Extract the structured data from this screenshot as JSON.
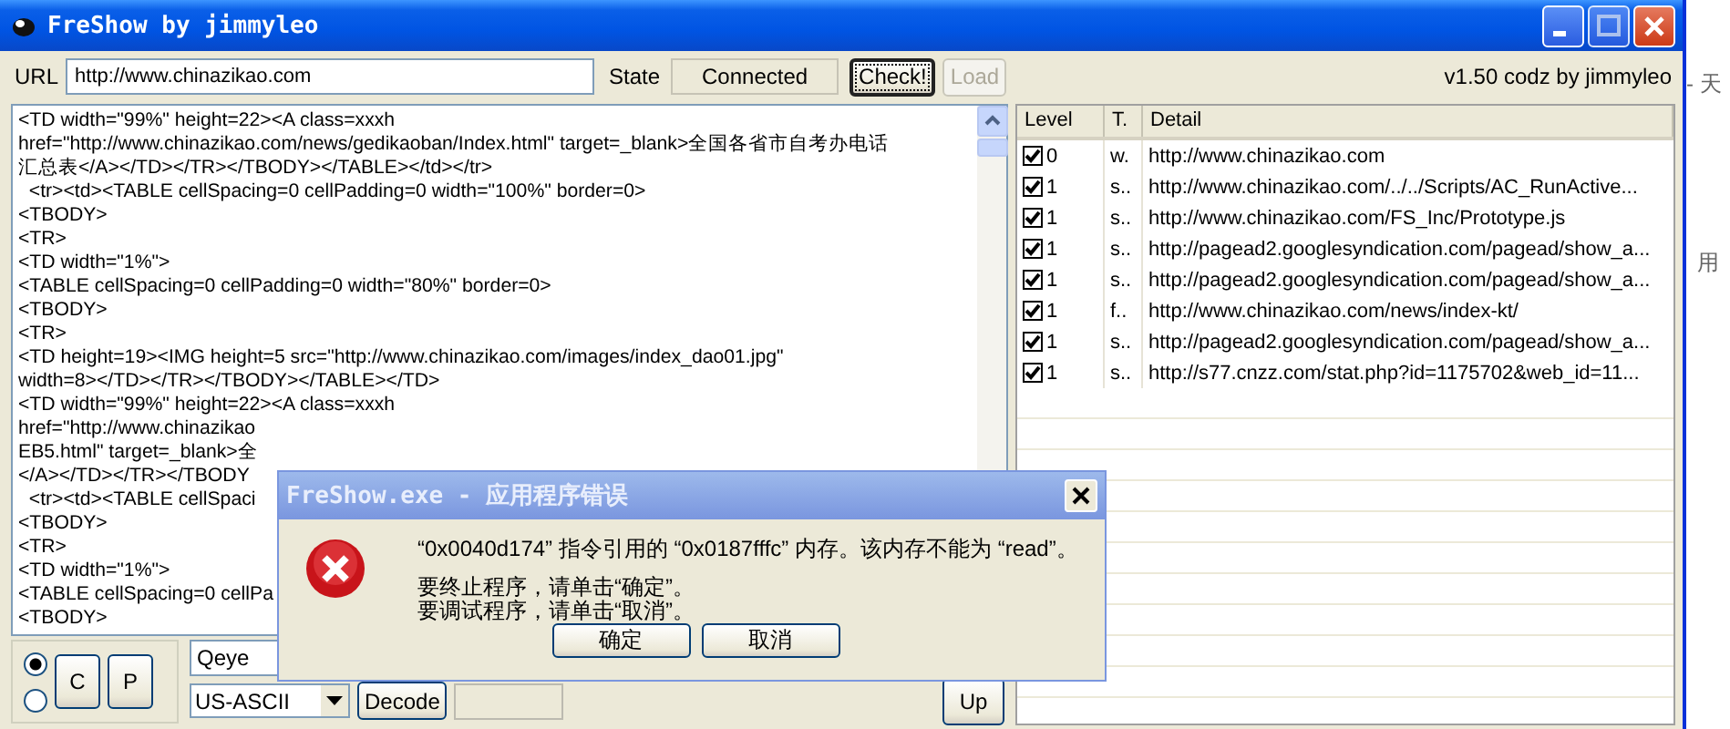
{
  "window": {
    "title": "FreShow by jimmyleo"
  },
  "toolbar": {
    "url_label": "URL",
    "url": "http://www.chinazikao.com",
    "state_label": "State",
    "state": "Connected",
    "buttons": [
      {
        "label": "Check!",
        "disabled": false,
        "focused": true
      },
      {
        "label": "Load",
        "disabled": true,
        "focused": false
      }
    ],
    "version": "v1.50 codz by jimmyleo"
  },
  "source_lines": [
    "<TD width=\"99%\" height=22><A class=xxxh",
    "href=\"http://www.chinazikao.com/news/gedikaoban/Index.html\" target=_blank>全国各省市自考办电话",
    "汇总表</A></TD></TR></TBODY></TABLE></td></tr>",
    "  <tr><td><TABLE cellSpacing=0 cellPadding=0 width=\"100%\" border=0>",
    "<TBODY>",
    "<TR>",
    "<TD width=\"1%\">",
    "<TABLE cellSpacing=0 cellPadding=0 width=\"80%\" border=0>",
    "<TBODY>",
    "<TR>",
    "<TD height=19><IMG height=5 src=\"http://www.chinazikao.com/images/index_dao01.jpg\"",
    "width=8></TD></TR></TBODY></TABLE></TD>",
    "<TD width=\"99%\" height=22><A class=xxxh",
    "href=\"http://www.chinazikao",
    "EB5.html\" target=_blank>全",
    "</A></TD></TR></TBODY",
    "  <tr><td><TABLE cellSpaci",
    "<TBODY>",
    "<TR>",
    "<TD width=\"1%\">",
    "<TABLE cellSpacing=0 cellPa",
    "<TBODY>"
  ],
  "list": {
    "columns": [
      "Level",
      "T.",
      "Detail"
    ],
    "rows": [
      {
        "checked": true,
        "level": "0",
        "type": "w.",
        "detail": "http://www.chinazikao.com"
      },
      {
        "checked": true,
        "level": "1",
        "type": "s..",
        "detail": "http://www.chinazikao.com/../../Scripts/AC_RunActive..."
      },
      {
        "checked": true,
        "level": "1",
        "type": "s..",
        "detail": "http://www.chinazikao.com/FS_Inc/Prototype.js"
      },
      {
        "checked": true,
        "level": "1",
        "type": "s..",
        "detail": "http://pagead2.googlesyndication.com/pagead/show_a..."
      },
      {
        "checked": true,
        "level": "1",
        "type": "s..",
        "detail": "http://pagead2.googlesyndication.com/pagead/show_a..."
      },
      {
        "checked": true,
        "level": "1",
        "type": "f..",
        "detail": "http://www.chinazikao.com/news/index-kt/"
      },
      {
        "checked": true,
        "level": "1",
        "type": "s..",
        "detail": "http://pagead2.googlesyndication.com/pagead/show_a..."
      },
      {
        "checked": true,
        "level": "1",
        "type": "s..",
        "detail": "http://s77.cnzz.com/stat.php?id=1175702&web_id=11..."
      }
    ]
  },
  "bottom": {
    "radios": [
      {
        "selected": true
      },
      {
        "selected": false
      }
    ],
    "buttons": [
      "C",
      "P"
    ],
    "query": "Qeye",
    "encoding": "US-ASCII",
    "decode": "Decode",
    "up": "Up"
  },
  "dialog": {
    "title": "FreShow.exe - 应用程序错误",
    "message": "“0x0040d174” 指令引用的 “0x0187fffc” 内存。该内存不能为 “read”。",
    "hints": [
      "要终止程序，请单击“确定”。",
      "要调试程序，请单击“取消”。"
    ],
    "buttons": [
      "确定",
      "取消"
    ]
  },
  "background": {
    "texts": [
      "- 天",
      "用"
    ]
  }
}
